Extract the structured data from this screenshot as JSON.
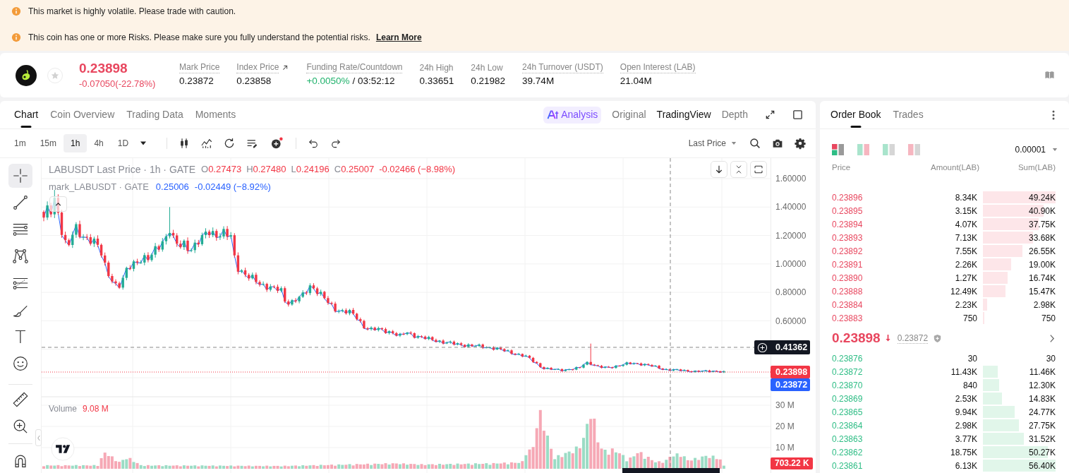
{
  "banners": [
    {
      "text": "This market is highly volatile. Please trade with caution."
    },
    {
      "text": "This coin has one or more Risks. Please make sure you fully understand the potential risks.",
      "link": "Learn More"
    }
  ],
  "ticker": {
    "favorite": false,
    "price": "0.23898",
    "change": "-0.07050(-22.78%)",
    "rising": false,
    "stats": [
      {
        "label": "Mark Price",
        "value": "0.23872",
        "dotted": true,
        "external": false,
        "positive": false
      },
      {
        "label": "Index Price",
        "value": "0.23858",
        "dotted": true,
        "external": true,
        "positive": false
      },
      {
        "label": "Funding Rate/Countdown",
        "value": "+0.0050%",
        "countdown": "/ 03:52:12",
        "dotted": true,
        "external": false,
        "positive": true
      },
      {
        "label": "24h High",
        "value": "0.33651",
        "dotted": false,
        "external": false,
        "positive": false
      },
      {
        "label": "24h Low",
        "value": "0.21982",
        "dotted": false,
        "external": false,
        "positive": false
      },
      {
        "label": "24h Turnover (USDT)",
        "value": "39.74M",
        "dotted": true,
        "external": false,
        "positive": false
      },
      {
        "label": "Open Interest (LAB)",
        "value": "21.04M",
        "dotted": true,
        "external": false,
        "positive": false
      }
    ]
  },
  "chart": {
    "tabs": [
      {
        "label": "Chart",
        "selected": true
      },
      {
        "label": "Coin Overview",
        "selected": false
      },
      {
        "label": "Trading Data",
        "selected": false
      },
      {
        "label": "Moments",
        "selected": false
      }
    ],
    "views": [
      {
        "label": "Analysis",
        "kind": "ai",
        "selected": false
      },
      {
        "label": "Original",
        "kind": "plain",
        "selected": false
      },
      {
        "label": "TradingView",
        "kind": "plain",
        "selected": true
      },
      {
        "label": "Depth",
        "kind": "plain",
        "selected": false
      }
    ],
    "intervals": [
      {
        "label": "1m",
        "selected": false
      },
      {
        "label": "15m",
        "selected": false
      },
      {
        "label": "1h",
        "selected": true
      },
      {
        "label": "4h",
        "selected": false
      },
      {
        "label": "1D",
        "selected": false
      }
    ],
    "price_source": "Last Price",
    "tool_groups": [
      [
        {
          "kind": "crosshair",
          "selected": true
        },
        {
          "kind": "trend-line",
          "selected": false
        },
        {
          "kind": "parallel-lines",
          "selected": false
        },
        {
          "kind": "pattern",
          "selected": false
        },
        {
          "kind": "fibonacci",
          "selected": false
        },
        {
          "kind": "brush",
          "selected": false
        },
        {
          "kind": "text",
          "glyph": "T",
          "selected": false
        },
        {
          "kind": "emoji",
          "selected": false
        }
      ],
      [
        {
          "kind": "ruler",
          "selected": false
        },
        {
          "kind": "zoom",
          "selected": false
        }
      ],
      [
        {
          "kind": "magnet",
          "selected": false
        }
      ]
    ],
    "legend": {
      "title": "LABUSDT Last Price · 1h · GATE",
      "ohlc": [
        {
          "key": "O",
          "value": "0.27473"
        },
        {
          "key": "H",
          "value": "0.27480"
        },
        {
          "key": "L",
          "value": "0.24196"
        },
        {
          "key": "C",
          "value": "0.25007"
        }
      ],
      "change": "-0.02466 (−8.98%)",
      "rising": false
    },
    "mark_legend": {
      "title": "mark_LABUSDT · GATE",
      "value": "0.25006",
      "change": "-0.02449 (−8.92%)"
    },
    "price_ticks": [
      "1.60000",
      "1.40000",
      "1.20000",
      "1.00000",
      "0.80000",
      "0.60000"
    ],
    "crosshair_price": "0.41362",
    "last_price": "0.23898",
    "mark_price": "0.23872",
    "volume": {
      "label": "Volume",
      "value": "9.08 M",
      "ticks": [
        "30 M",
        "20 M",
        "10 M"
      ],
      "last": "703.22 K"
    }
  },
  "order_book": {
    "tabs": [
      {
        "label": "Order Book",
        "selected": true
      },
      {
        "label": "Trades",
        "selected": false
      }
    ],
    "layouts": [
      {
        "kind": "both",
        "selected": true
      },
      {
        "kind": "split",
        "selected": false
      },
      {
        "kind": "bids",
        "selected": false
      },
      {
        "kind": "asks",
        "selected": false
      }
    ],
    "precision": "0.00001",
    "columns": [
      "Price",
      "Amount(LAB)",
      "Sum(LAB)"
    ],
    "asks": [
      {
        "price": "0.23896",
        "amount": "8.34K",
        "sum": "49.24K"
      },
      {
        "price": "0.23895",
        "amount": "3.15K",
        "sum": "40.90K"
      },
      {
        "price": "0.23894",
        "amount": "4.07K",
        "sum": "37.75K"
      },
      {
        "price": "0.23893",
        "amount": "7.13K",
        "sum": "33.68K"
      },
      {
        "price": "0.23892",
        "amount": "7.55K",
        "sum": "26.55K"
      },
      {
        "price": "0.23891",
        "amount": "2.26K",
        "sum": "19.00K"
      },
      {
        "price": "0.23890",
        "amount": "1.27K",
        "sum": "16.74K"
      },
      {
        "price": "0.23888",
        "amount": "12.49K",
        "sum": "15.47K"
      },
      {
        "price": "0.23884",
        "amount": "2.23K",
        "sum": "2.98K"
      },
      {
        "price": "0.23883",
        "amount": "750",
        "sum": "750"
      }
    ],
    "last_price": "0.23898",
    "rising": false,
    "mark_price": "0.23872",
    "bids": [
      {
        "price": "0.23876",
        "amount": "30",
        "sum": "30"
      },
      {
        "price": "0.23872",
        "amount": "11.43K",
        "sum": "11.46K"
      },
      {
        "price": "0.23870",
        "amount": "840",
        "sum": "12.30K"
      },
      {
        "price": "0.23869",
        "amount": "2.53K",
        "sum": "14.83K"
      },
      {
        "price": "0.23865",
        "amount": "9.94K",
        "sum": "24.77K"
      },
      {
        "price": "0.23864",
        "amount": "2.98K",
        "sum": "27.75K"
      },
      {
        "price": "0.23863",
        "amount": "3.77K",
        "sum": "31.52K"
      },
      {
        "price": "0.23862",
        "amount": "18.75K",
        "sum": "50.27K"
      },
      {
        "price": "0.23861",
        "amount": "6.13K",
        "sum": "56.40K"
      }
    ]
  }
}
